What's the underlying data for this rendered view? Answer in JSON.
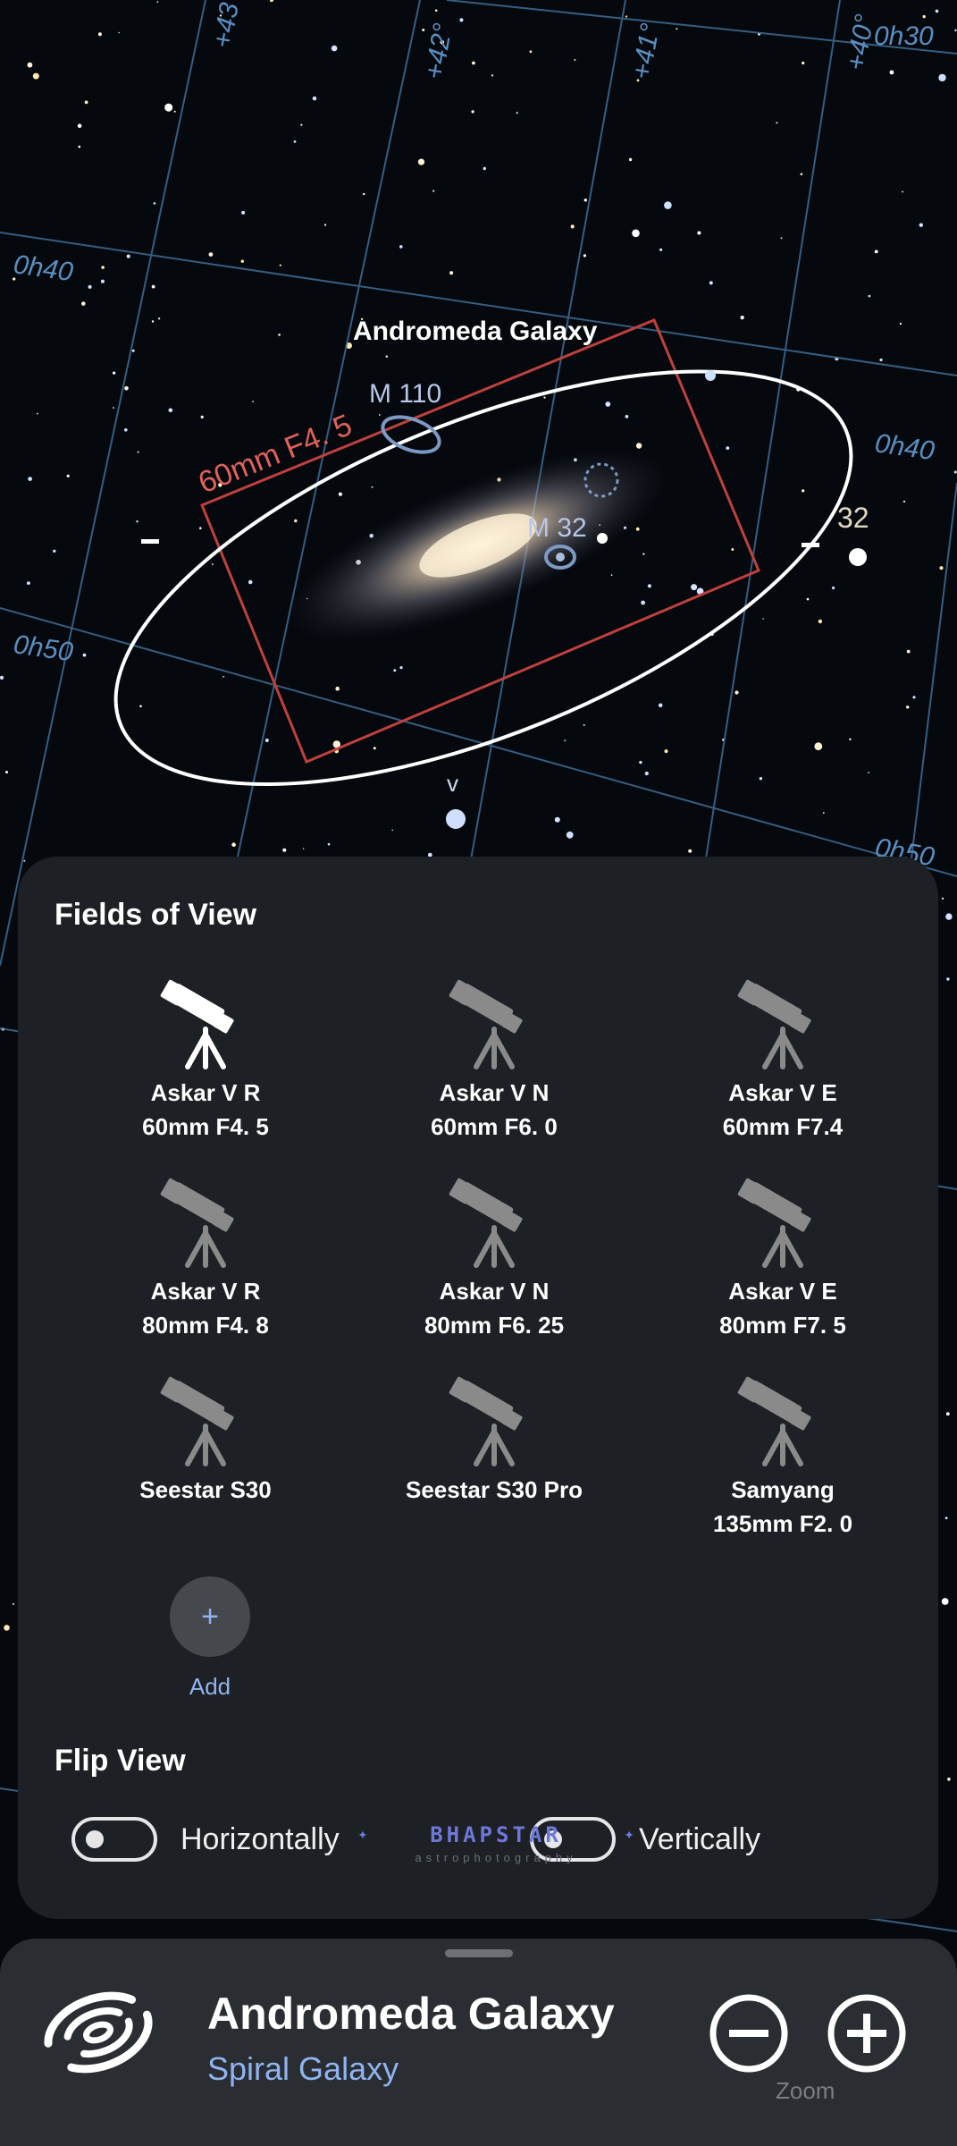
{
  "sky": {
    "ra_labels": [
      "0h30",
      "0h40",
      "0h40",
      "0h50",
      "0h50"
    ],
    "dec_labels": [
      "+43°",
      "+42°",
      "+41°",
      "+40°"
    ],
    "object_label": "Andromeda Galaxy",
    "frame_label": "60mm F4. 5",
    "m110_label": "M 110",
    "m32_label": "M 32",
    "star_32_label": "32",
    "star_nu_label": "v"
  },
  "fov_panel": {
    "title": "Fields of View",
    "items": [
      {
        "name": "Askar V R",
        "spec": "60mm F4. 5",
        "selected": true
      },
      {
        "name": "Askar V N",
        "spec": "60mm F6. 0",
        "selected": false
      },
      {
        "name": "Askar V E",
        "spec": "60mm F7.4",
        "selected": false
      },
      {
        "name": "Askar V R",
        "spec": "80mm F4. 8",
        "selected": false
      },
      {
        "name": "Askar V N",
        "spec": "80mm F6. 25",
        "selected": false
      },
      {
        "name": "Askar V E",
        "spec": "80mm F7. 5",
        "selected": false
      },
      {
        "name": "Seestar S30",
        "spec": "",
        "selected": false
      },
      {
        "name": "Seestar S30 Pro",
        "spec": "",
        "selected": false
      },
      {
        "name": "Samyang",
        "spec": "135mm F2. 0",
        "selected": false
      }
    ],
    "add_icon": "+",
    "add_label": "Add",
    "flip_title": "Flip View",
    "flip_horizontal_label": "Horizontally",
    "flip_vertical_label": "Vertically",
    "flip_horizontal_on": false,
    "flip_vertical_on": false
  },
  "watermark": {
    "main": "BHAPSTAR",
    "sub": "astrophotography"
  },
  "bottom_bar": {
    "object_name": "Andromeda Galaxy",
    "object_type": "Spiral Galaxy",
    "object_icon": "spiral-galaxy-icon",
    "zoom_out_icon": "minus-circle-icon",
    "zoom_in_icon": "plus-circle-icon",
    "zoom_label": "Zoom"
  },
  "colors": {
    "panel_bg": "#1d2024",
    "bar_bg": "#2a2d32",
    "accent_blue": "#8fb4f0",
    "grid_line": "#5a8fc0",
    "frame_red": "#d9534f",
    "icon_selected": "#ffffff",
    "icon_unselected": "#8a8a8a"
  }
}
